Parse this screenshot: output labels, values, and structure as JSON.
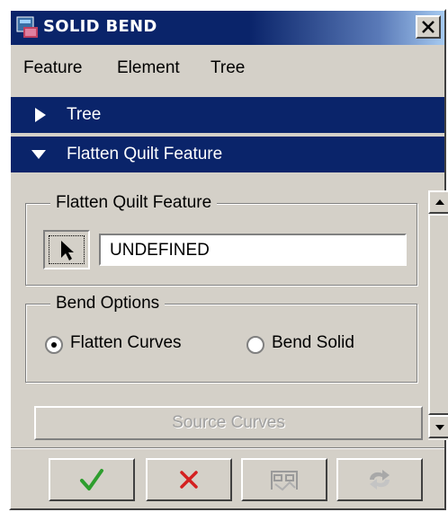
{
  "window": {
    "title": "SOLID BEND",
    "icons": {
      "app": "app-icon",
      "close": "close-icon"
    }
  },
  "menu": {
    "items": [
      "Feature",
      "Element",
      "Tree"
    ]
  },
  "sections": {
    "tree": {
      "label": "Tree",
      "state": "collapsed",
      "icon": "triangle-right-icon"
    },
    "flatten": {
      "label": "Flatten Quilt Feature",
      "state": "expanded",
      "icon": "triangle-down-icon"
    }
  },
  "flatten_group": {
    "title": "Flatten Quilt Feature",
    "selector_icon": "arrow-cursor-icon",
    "value": "UNDEFINED"
  },
  "bend_group": {
    "title": "Bend Options",
    "options": [
      {
        "label": "Flatten Curves",
        "checked": true
      },
      {
        "label": "Bend Solid",
        "checked": false
      }
    ]
  },
  "source_button": {
    "label": "Source Curves",
    "enabled": false
  },
  "actions": [
    {
      "name": "ok",
      "icon": "checkmark-icon"
    },
    {
      "name": "cancel",
      "icon": "x-icon"
    },
    {
      "name": "preview",
      "icon": "preview-glasses-icon"
    },
    {
      "name": "repeat",
      "icon": "repeat-arrows-icon"
    }
  ],
  "colors": {
    "titlebar": "#0a246a",
    "header": "#0a246a",
    "face": "#d4d0c8",
    "ok_green": "#2e9e2e",
    "cancel_red": "#d42020"
  }
}
